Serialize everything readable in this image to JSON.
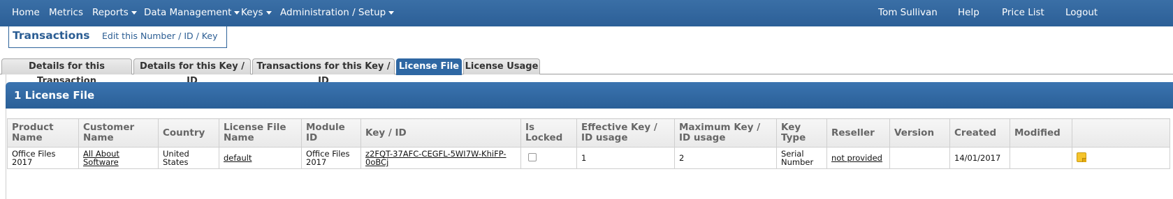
{
  "nav": {
    "home": "Home",
    "metrics": "Metrics",
    "reports": "Reports",
    "data_management": "Data Management",
    "keys": "Keys",
    "admin_setup": "Administration / Setup",
    "user": "Tom Sullivan",
    "help": "Help",
    "price_list": "Price List",
    "logout": "Logout"
  },
  "subheader": {
    "title": "Transactions",
    "edit_link": "Edit this Number / ID / Key"
  },
  "tabs": [
    {
      "label": "Details for this Transaction"
    },
    {
      "label": "Details for this Key / ID"
    },
    {
      "label": "Transactions for this Key / ID"
    },
    {
      "label": "License File"
    },
    {
      "label": "License Usage"
    }
  ],
  "active_tab": "License File",
  "panel": {
    "title": "1 License File"
  },
  "table": {
    "headers": {
      "product_name": "Product Name",
      "customer_name": "Customer Name",
      "country": "Country",
      "license_file_name": "License File Name",
      "module_id": "Module ID",
      "key_id": "Key / ID",
      "is_locked": "Is Locked",
      "effective_usage": "Effective Key / ID usage",
      "maximum_usage": "Maximum Key / ID usage",
      "key_type": "Key Type",
      "reseller": "Reseller",
      "version": "Version",
      "created": "Created",
      "modified": "Modified"
    },
    "rows": [
      {
        "product_name": "Office Files 2017",
        "customer_name": "All About Software",
        "country": "United States",
        "license_file_name": "default",
        "module_id": "Office Files 2017",
        "key_id": "z2FQT-37AFC-CEGFL-5WI7W-KhiFP-0oBCj",
        "is_locked": false,
        "effective_usage": "1",
        "maximum_usage": "2",
        "key_type": "Serial Number",
        "reseller": "not provided",
        "version": "",
        "created": "14/01/2017",
        "modified": "",
        "action_icon": "note-icon"
      }
    ]
  },
  "colors": {
    "nav_bg": "#2f629a",
    "active_tab": "#2e67a3",
    "panel_header": "#2f6aa6",
    "link_blue": "#2b5d93"
  }
}
